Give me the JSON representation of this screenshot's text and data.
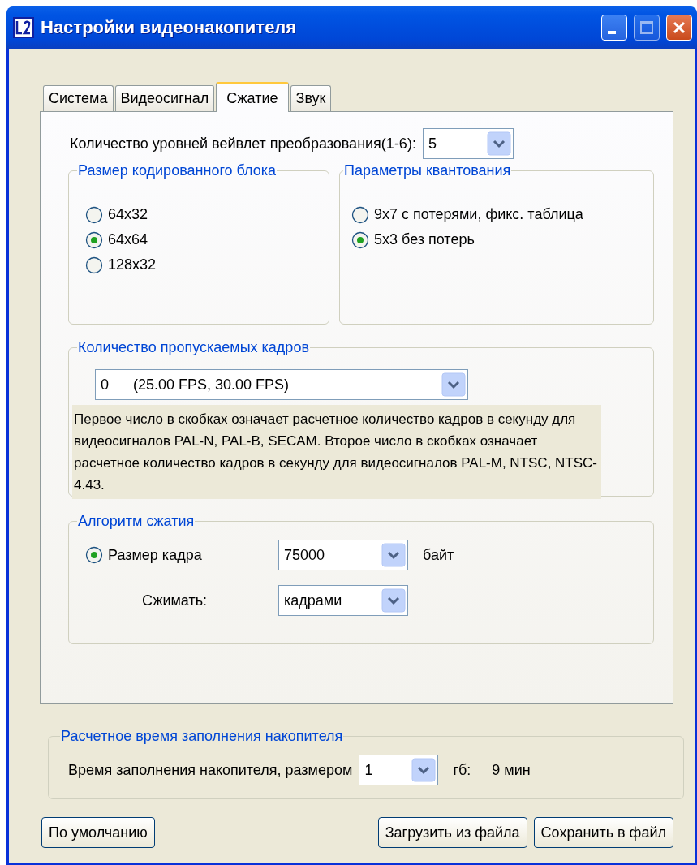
{
  "window": {
    "title": "Настройки видеонакопителя"
  },
  "tabs": [
    {
      "label": "Система",
      "selected": false
    },
    {
      "label": "Видеосигнал",
      "selected": false
    },
    {
      "label": "Сжатие",
      "selected": true
    },
    {
      "label": "Звук",
      "selected": false
    }
  ],
  "wavelet": {
    "label": "Количество уровней вейвлет преобразования(1-6):",
    "value": "5"
  },
  "block_size": {
    "title": "Размер кодированного блока",
    "options": [
      {
        "label": "64x32",
        "selected": false
      },
      {
        "label": "64x64",
        "selected": true
      },
      {
        "label": "128x32",
        "selected": false
      }
    ]
  },
  "quantization": {
    "title": "Параметры квантования",
    "options": [
      {
        "label": "9x7 с потерями, фикс. таблица",
        "selected": false
      },
      {
        "label": "5x3 без потерь",
        "selected": true
      }
    ]
  },
  "skipped_frames": {
    "title": "Количество пропускаемых кадров",
    "value": "0",
    "rate": "(25.00 FPS, 30.00 FPS)",
    "note": "Первое число в скобках означает расчетное количество кадров в секунду для видеосигналов PAL-N, PAL-B, SECAM. Второе число в скобках означает расчетное количество кадров в секунду для видеосигналов PAL-M, NTSC, NTSC-4.43."
  },
  "compression": {
    "title": "Алгоритм сжатия",
    "mode": {
      "label": "Размер кадра",
      "selected": true
    },
    "frame_size": {
      "value": "75000",
      "unit": "байт"
    },
    "compress": {
      "label": "Сжимать:",
      "value": "кадрами"
    }
  },
  "fill_time": {
    "title": "Расчетное время заполнения накопителя",
    "label": "Время заполнения накопителя, размером",
    "size": "1",
    "unit": "гб:",
    "result": "9 мин"
  },
  "buttons": [
    {
      "label": "По умолчанию"
    },
    {
      "label": "Загрузить из файла"
    },
    {
      "label": "Сохранить в файл"
    }
  ]
}
